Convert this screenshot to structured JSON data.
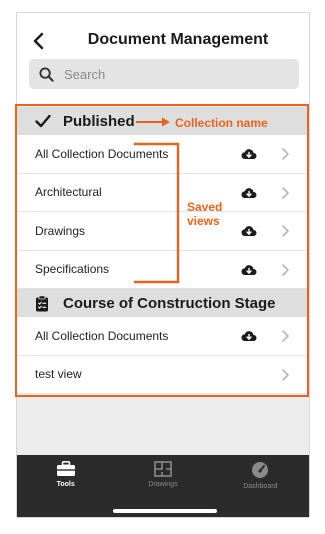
{
  "header": {
    "title": "Document Management",
    "search_placeholder": "Search"
  },
  "collections": [
    {
      "name": "Published",
      "rows": [
        {
          "label": "All Collection Documents",
          "download": true
        },
        {
          "label": "Architectural",
          "download": true
        },
        {
          "label": "Drawings",
          "download": true
        },
        {
          "label": "Specifications",
          "download": true
        }
      ]
    },
    {
      "name": "Course of Construction Stage",
      "rows": [
        {
          "label": "All Collection Documents",
          "download": true
        },
        {
          "label": "test view",
          "download": false
        }
      ]
    }
  ],
  "annotations": {
    "collection_name": "Collection name",
    "saved_views_line1": "Saved",
    "saved_views_line2": "views",
    "color": "#e8641e"
  },
  "tabbar": {
    "tabs": [
      {
        "label": "Tools",
        "icon": "toolbox-icon",
        "active": true
      },
      {
        "label": "Drawings",
        "icon": "drawings-icon",
        "active": false
      },
      {
        "label": "Dashboard",
        "icon": "gauge-icon",
        "active": false
      }
    ]
  }
}
